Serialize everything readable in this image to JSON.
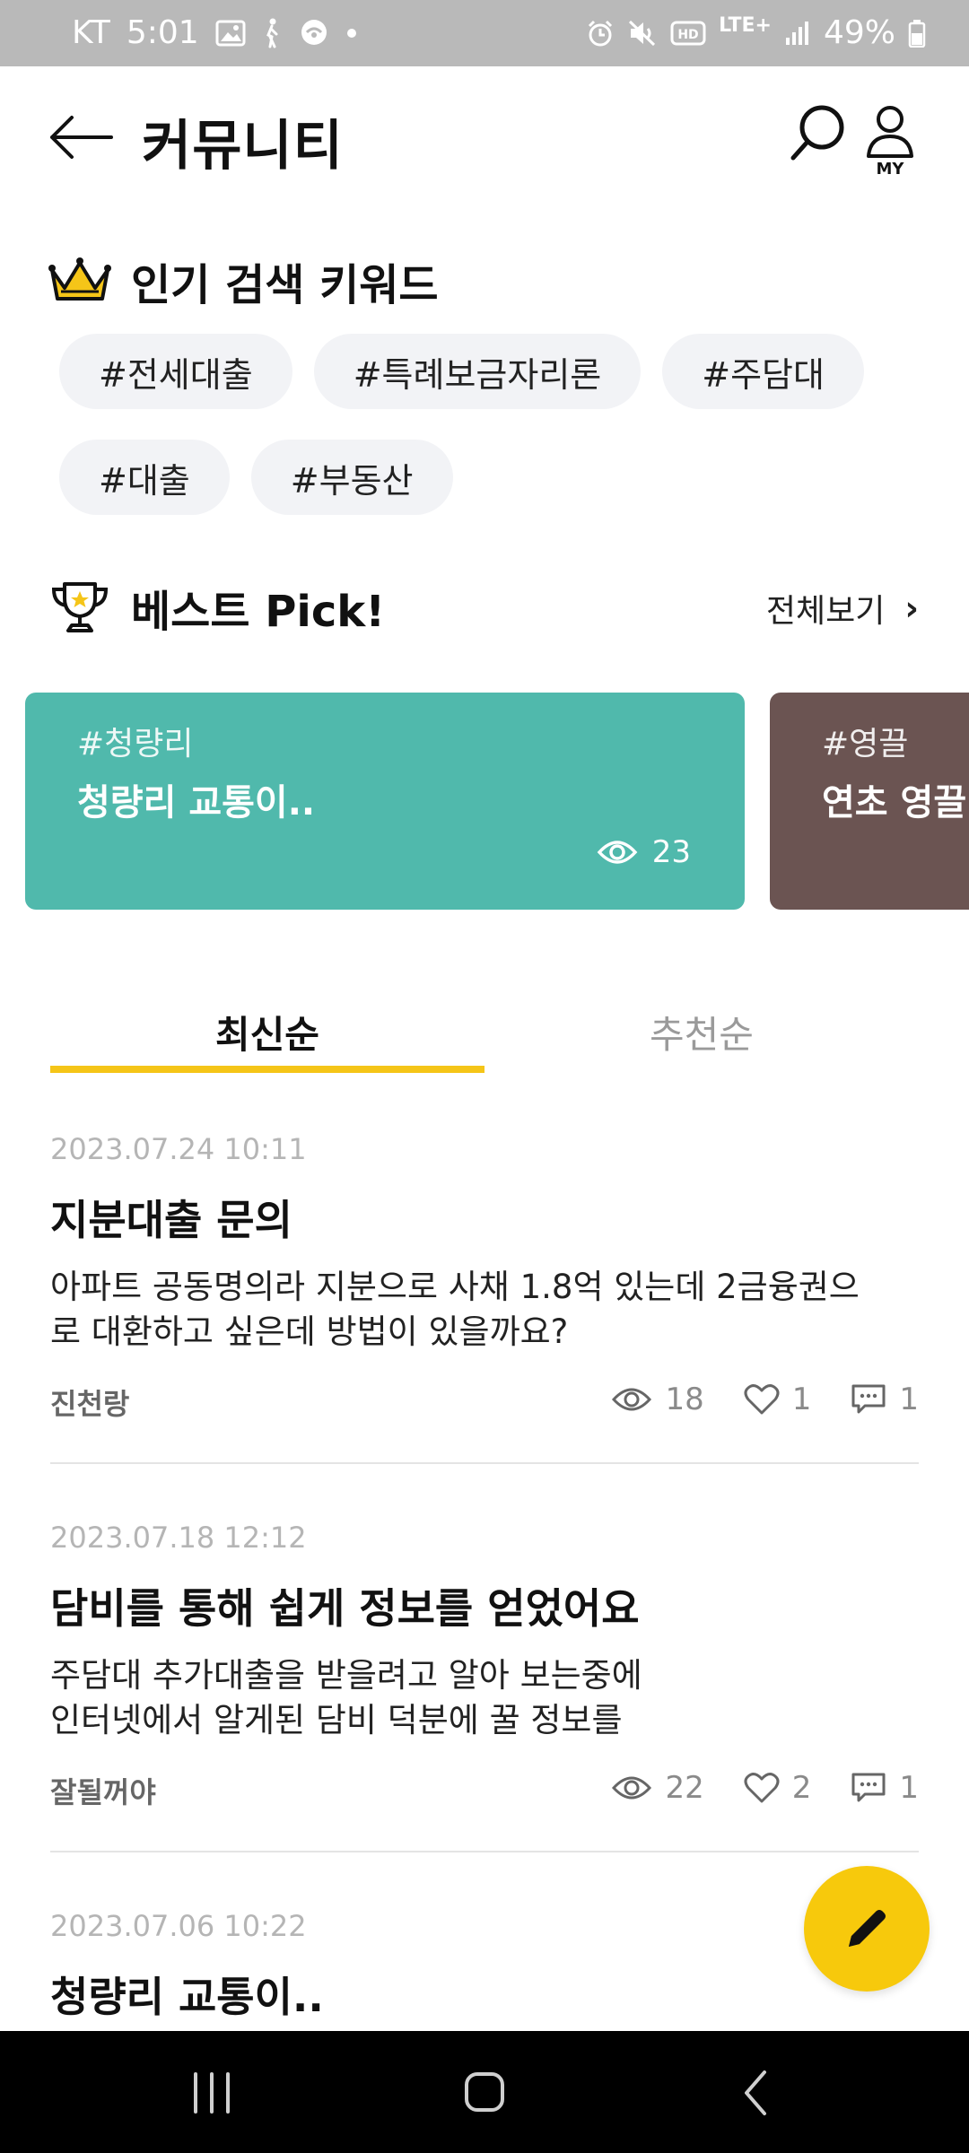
{
  "status_bar": {
    "carrier": "KT",
    "time": "5:01",
    "network": "LTE+",
    "battery": "49%"
  },
  "header": {
    "title": "커뮤니티",
    "my_label": "MY"
  },
  "keywords": {
    "title": "인기 검색 키워드",
    "items": [
      "#전세대출",
      "#특례보금자리론",
      "#주담대",
      "#대출",
      "#부동산"
    ]
  },
  "best_pick": {
    "title": "베스트 Pick!",
    "view_all": "전체보기",
    "cards": [
      {
        "tag": "#청량리",
        "title": "청량리 교통이..",
        "views": "23",
        "color": "#50b9ac"
      },
      {
        "tag": "#영끌",
        "title": "연초 영끌",
        "color": "#6b5452"
      }
    ]
  },
  "tabs": {
    "items": [
      "최신순",
      "추천순"
    ],
    "active": "최신순",
    "accent": "#f5c518"
  },
  "posts": [
    {
      "date": "2023.07.24 10:11",
      "title": "지분대출 문의",
      "body_lines": [
        "아파트 공동명의라 지분으로 사채 1.8억 있는데 2금융권으",
        "로 대환하고 싶은데 방법이 있을까요?"
      ],
      "author": "진천랑",
      "views": "18",
      "likes": "1",
      "comments": "1"
    },
    {
      "date": "2023.07.18 12:12",
      "title": "담비를 통해 쉽게 정보를 얻었어요",
      "body_lines": [
        "주담대 추가대출을 받을려고 알아 보는중에",
        "인터넷에서 알게된 담비 덕분에 꿀 정보를"
      ],
      "author": "잘될꺼야",
      "views": "22",
      "likes": "2",
      "comments": "1"
    },
    {
      "date": "2023.07.06 10:22",
      "title": "청량리 교통이.."
    }
  ],
  "fab": {
    "icon": "pencil-icon",
    "color": "#f7c90c"
  }
}
